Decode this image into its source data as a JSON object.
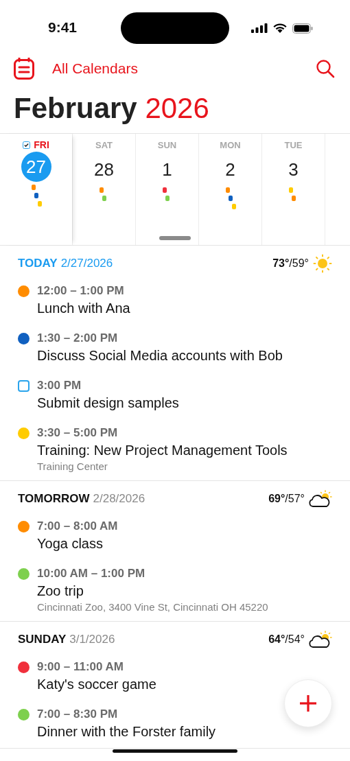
{
  "status_bar": {
    "time": "9:41"
  },
  "nav": {
    "title": "All Calendars"
  },
  "header": {
    "month": "February",
    "year": "2026"
  },
  "day_strip": [
    {
      "name": "FRI",
      "number": "27",
      "selected": true,
      "dots": [
        {
          "color": "#ff8c00"
        },
        {
          "color": "#1060c0"
        },
        {
          "color": "#ffcc00"
        }
      ]
    },
    {
      "name": "SAT",
      "number": "28",
      "selected": false,
      "dots": [
        {
          "color": "#ff8c00"
        },
        {
          "color": "#7ed04e"
        }
      ]
    },
    {
      "name": "SUN",
      "number": "1",
      "selected": false,
      "dots": [
        {
          "color": "#f0303c"
        },
        {
          "color": "#7ed04e"
        }
      ]
    },
    {
      "name": "MON",
      "number": "2",
      "selected": false,
      "dots": [
        {
          "color": "#ff8c00"
        },
        {
          "color": "#1060c0"
        },
        {
          "color": "#ffcc00"
        }
      ]
    },
    {
      "name": "TUE",
      "number": "3",
      "selected": false,
      "dots": [
        {
          "color": "#ffcc00"
        },
        {
          "color": "#ff8c00"
        }
      ]
    }
  ],
  "sections": [
    {
      "label": "TODAY",
      "date": "2/27/2026",
      "today": true,
      "high": "73°",
      "low": "/59°",
      "weather": {
        "kind": "sunny"
      },
      "events": [
        {
          "kind": "event",
          "color": "#ff8c00",
          "time": "12:00 – 1:00 PM",
          "title": "Lunch with Ana"
        },
        {
          "kind": "event",
          "color": "#1060c0",
          "time": "1:30 – 2:00 PM",
          "title": "Discuss Social Media accounts with Bob"
        },
        {
          "kind": "task",
          "color": "#2aa4ec",
          "time": "3:00 PM",
          "title": "Submit design samples"
        },
        {
          "kind": "event",
          "color": "#ffcc00",
          "time": "3:30 – 5:00 PM",
          "title": "Training: New Project Management Tools",
          "location": "Training Center"
        }
      ]
    },
    {
      "label": "TOMORROW",
      "date": "2/28/2026",
      "today": false,
      "high": "69°",
      "low": "/57°",
      "weather": {
        "kind": "partly-cloudy"
      },
      "events": [
        {
          "kind": "event",
          "color": "#ff8c00",
          "time": "7:00 – 8:00 AM",
          "title": "Yoga class"
        },
        {
          "kind": "event",
          "color": "#7ed04e",
          "time": "10:00 AM – 1:00 PM",
          "title": "Zoo trip",
          "location": "Cincinnati Zoo, 3400 Vine St, Cincinnati OH 45220"
        }
      ]
    },
    {
      "label": "SUNDAY",
      "date": "3/1/2026",
      "today": false,
      "high": "64°",
      "low": "/54°",
      "weather": {
        "kind": "partly-cloudy"
      },
      "events": [
        {
          "kind": "event",
          "color": "#f0303c",
          "time": "9:00 – 11:00 AM",
          "title": "Katy's soccer game"
        },
        {
          "kind": "event",
          "color": "#7ed04e",
          "time": "7:00 – 8:30 PM",
          "title": "Dinner with the Forster family"
        }
      ]
    }
  ]
}
